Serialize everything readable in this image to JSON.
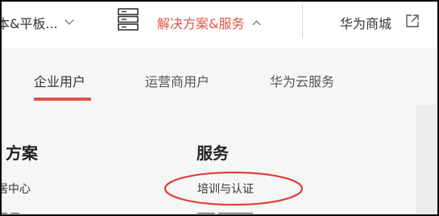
{
  "topnav": {
    "laptops_label": "本&平板...",
    "solutions_label": "解决方案&服务",
    "mall_label": "华为商城"
  },
  "tabs": [
    {
      "label": "企业用户"
    },
    {
      "label": "运营商用户"
    },
    {
      "label": "华为云服务"
    }
  ],
  "columns": {
    "solutions_title": "方案",
    "solutions_first_link": "居中心",
    "services_title": "服务",
    "services_first_link": "培训与认证"
  },
  "colors": {
    "accent": "#e0534a",
    "annotation_ellipse": "#e0413c",
    "panel_bg": "#f6f6f6"
  },
  "icons": [
    "chevron-down-icon",
    "server-icon",
    "chevron-up-icon",
    "external-link-icon"
  ]
}
